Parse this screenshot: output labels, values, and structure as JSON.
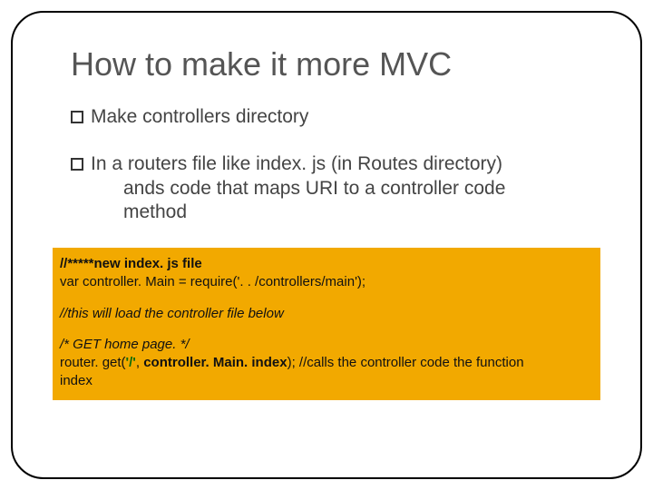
{
  "title": "How to make it more MVC",
  "bullets": [
    {
      "text": "Make controllers directory"
    },
    {
      "text": "In a routers file like index. js (in Routes directory)",
      "cont1": "ands code that maps URI to a controller code",
      "cont2": "method"
    }
  ],
  "code": {
    "l1a": "//*****new index. js file",
    "l2a": "var controller. Main = require('. . /controllers/main');",
    "l3a": "//this will load the controller file below",
    "l4a": "/* GET home page. */",
    "l5a": "router. get",
    "l5b": "(",
    "l5c": "'/'",
    "l5d": ", ",
    "l5e": "controller. Main. index",
    "l5f": "); //calls the controller code the function",
    "l6a": "index"
  }
}
